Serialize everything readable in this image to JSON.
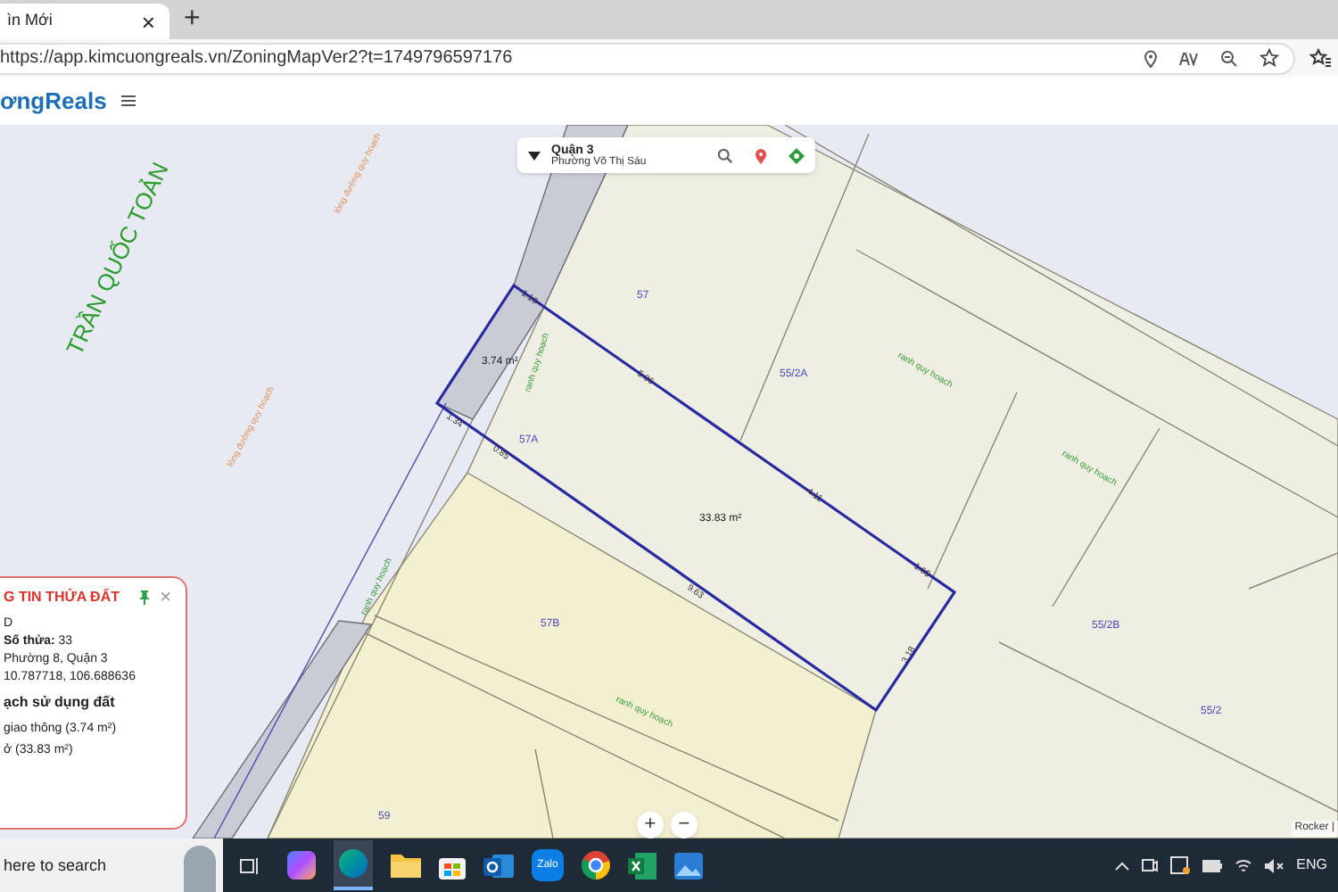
{
  "browser": {
    "tab": {
      "title": "ìn Mới",
      "close": "×",
      "selected": true
    },
    "new_tab": "+",
    "url": "https://app.kimcuongreals.vn/ZoningMapVer2?t=1749796597176"
  },
  "app_header": {
    "logo": "ơngReals"
  },
  "location_box": {
    "district": "Quận 3",
    "ward": "Phường Võ Thị Sáu"
  },
  "map": {
    "labels": [
      {
        "kind": "street",
        "text": "TRẦN QUỐC TOẢN"
      },
      {
        "kind": "road",
        "text": "lòng đường quy hoạch"
      },
      {
        "kind": "road",
        "text": "lòng đường quy hoạch"
      },
      {
        "kind": "boundary",
        "text": "ranh quy hoạch"
      },
      {
        "kind": "boundary",
        "text": "ranh quy hoạch"
      },
      {
        "kind": "boundary",
        "text": "ranh quy hoạch"
      },
      {
        "kind": "boundary",
        "text": "ranh quy hoạch"
      },
      {
        "kind": "boundary",
        "text": "ranh quy hoạch"
      },
      {
        "kind": "parcel",
        "text": "57"
      },
      {
        "kind": "parcel",
        "text": "55/2A"
      },
      {
        "kind": "parcel",
        "text": "57A"
      },
      {
        "kind": "parcel",
        "text": "57B"
      },
      {
        "kind": "parcel",
        "text": "55/2B"
      },
      {
        "kind": "parcel",
        "text": "55/2"
      },
      {
        "kind": "parcel",
        "text": "59"
      },
      {
        "kind": "area",
        "text": "3.74 m²"
      },
      {
        "kind": "area",
        "text": "33.83 m²"
      },
      {
        "kind": "edge",
        "text": "1.10"
      },
      {
        "kind": "edge",
        "text": "5.06"
      },
      {
        "kind": "edge",
        "text": "4.11"
      },
      {
        "kind": "edge",
        "text": "1.65"
      },
      {
        "kind": "edge",
        "text": "1.34"
      },
      {
        "kind": "edge",
        "text": "0.85"
      },
      {
        "kind": "edge",
        "text": "9.63"
      },
      {
        "kind": "edge",
        "text": "3.18"
      }
    ],
    "zoom_in": "+",
    "zoom_out": "−",
    "attribution": "Rocker |"
  },
  "info_panel": {
    "title": "G TIN THỬA ĐẤT",
    "close": "×",
    "rows": [
      "D",
      "**Số thửa:** 33",
      "Phường 8, Quận 3",
      "10.787718, 106.688636"
    ],
    "section_title": "ạch sử dụng đất",
    "uses": [
      "giao thông (3.74 m²)",
      "ở (33.83 m²)"
    ]
  },
  "taskbar": {
    "search": {
      "placeholder": "here to search"
    },
    "chat_app_label": "Zalo",
    "language": "ENG"
  }
}
